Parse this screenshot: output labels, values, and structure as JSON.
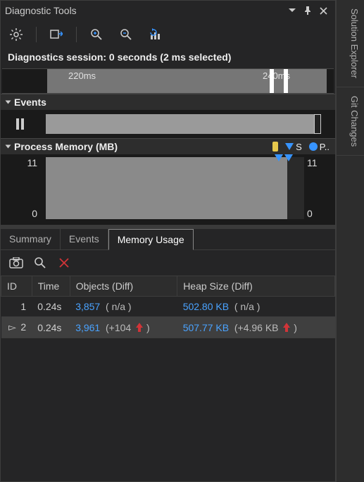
{
  "window": {
    "title": "Diagnostic Tools"
  },
  "session": {
    "text": "Diagnostics session: 0 seconds (2 ms selected)"
  },
  "ruler": {
    "t1": "220ms",
    "t2": "240ms"
  },
  "sections": {
    "events": "Events",
    "memory": "Process Memory (MB)"
  },
  "legend": {
    "s": "S",
    "p": "P.."
  },
  "mem_axis": {
    "top": "11",
    "bottom": "0"
  },
  "tabs": {
    "summary": "Summary",
    "events": "Events",
    "memory": "Memory Usage"
  },
  "table": {
    "headers": {
      "id": "ID",
      "time": "Time",
      "objects": "Objects (Diff)",
      "heap": "Heap Size (Diff)"
    },
    "rows": [
      {
        "id": "1",
        "time": "0.24s",
        "objects": "3,857",
        "objects_diff": "( n/a )",
        "heap": "502.80 KB",
        "heap_diff": "( n/a )",
        "up": false,
        "current": false
      },
      {
        "id": "2",
        "time": "0.24s",
        "objects": "3,961",
        "objects_diff": "(+104",
        "objects_diff_close": ")",
        "heap": "507.77 KB",
        "heap_diff": "(+4.96 KB",
        "heap_diff_close": ")",
        "up": true,
        "current": true
      }
    ]
  },
  "side": {
    "explorer": "Solution Explorer",
    "git": "Git Changes"
  }
}
